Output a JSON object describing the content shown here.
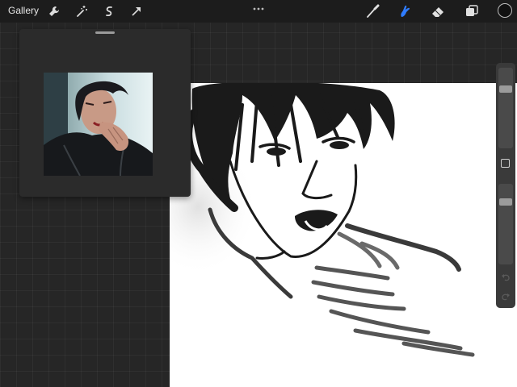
{
  "topbar": {
    "gallery_label": "Gallery"
  },
  "icons": {
    "actions": "wrench-icon",
    "adjustments": "magic-wand-icon",
    "selection": "s-curve-icon",
    "transform": "arrow-cursor-icon",
    "brush": "brush-icon",
    "smudge": "smudge-icon",
    "eraser": "eraser-icon",
    "layers": "layers-icon"
  },
  "colors": {
    "active_tool": "#2f7cff",
    "current_color": "#111111"
  },
  "sidebar": {
    "brush_size_level": 0.76,
    "opacity_level": 0.8
  }
}
